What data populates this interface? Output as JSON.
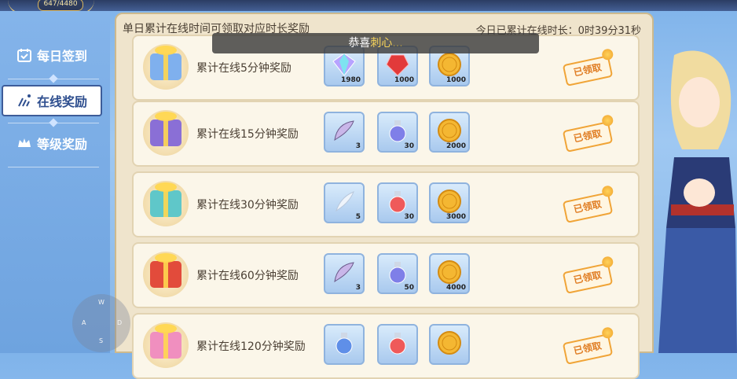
{
  "topbar": {
    "counter": "647/4480"
  },
  "sidebar": {
    "items": [
      {
        "label": "每日签到",
        "icon": "calendar-check-icon",
        "active": false
      },
      {
        "label": "在线奖励",
        "icon": "sparkle-icon",
        "active": true
      },
      {
        "label": "等级奖励",
        "icon": "crown-icon",
        "active": false
      }
    ]
  },
  "panel": {
    "title": "单日累计在线时间可领取对应时长奖励",
    "online_time_label": "今日已累计在线时长：",
    "online_time_value": "0时39分31秒"
  },
  "toast": {
    "prefix": "恭喜",
    "highlight": "刺心",
    "suffix": "..."
  },
  "rows": [
    {
      "label": "累计在线5分钟奖励",
      "gift_color": "#7fb0ee",
      "items": [
        {
          "icon": "diamond-icon",
          "qty": "1980"
        },
        {
          "icon": "ruby-icon",
          "qty": "1000"
        },
        {
          "icon": "gold-coin-icon",
          "qty": "1000"
        }
      ],
      "status": "已领取"
    },
    {
      "label": "累计在线15分钟奖励",
      "gift_color": "#8a6fd6",
      "items": [
        {
          "icon": "wing-icon",
          "qty": "3"
        },
        {
          "icon": "blue-potion-icon",
          "qty": "30"
        },
        {
          "icon": "gold-coin-icon",
          "qty": "2000"
        }
      ],
      "status": "已领取"
    },
    {
      "label": "累计在线30分钟奖励",
      "gift_color": "#5fc7c9",
      "items": [
        {
          "icon": "feather-icon",
          "qty": "5"
        },
        {
          "icon": "red-potion-icon",
          "qty": "30"
        },
        {
          "icon": "gold-coin-icon",
          "qty": "3000"
        }
      ],
      "status": "已领取"
    },
    {
      "label": "累计在线60分钟奖励",
      "gift_color": "#e24b3b",
      "items": [
        {
          "icon": "wing-icon",
          "qty": "3"
        },
        {
          "icon": "blue-potion-icon",
          "qty": "50"
        },
        {
          "icon": "gold-coin-icon",
          "qty": "4000"
        }
      ],
      "status": "已领取"
    },
    {
      "label": "累计在线120分钟奖励",
      "gift_color": "#f08fbf",
      "items": [
        {
          "icon": "blue-potion-icon",
          "qty": ""
        },
        {
          "icon": "red-potion-icon",
          "qty": ""
        },
        {
          "icon": "gold-coin-icon",
          "qty": ""
        }
      ],
      "status": "已领取"
    }
  ],
  "joystick": {
    "up": "W",
    "left": "A",
    "right": "D",
    "down": "S"
  }
}
